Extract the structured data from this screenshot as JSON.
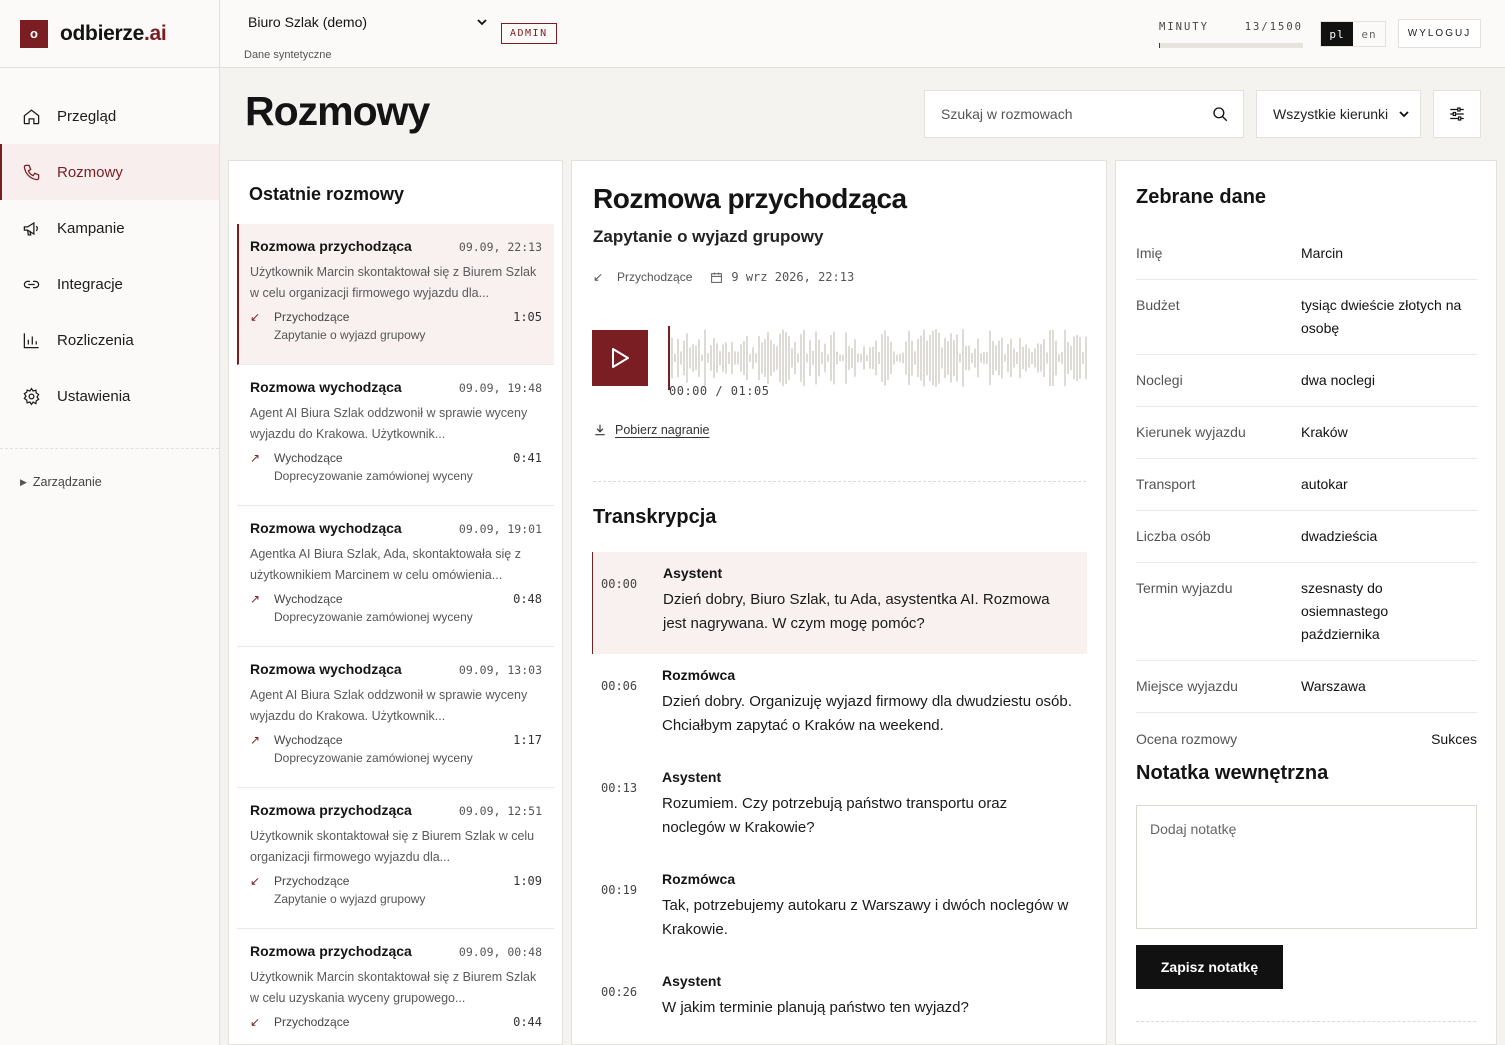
{
  "brand": {
    "mark": "o",
    "name": "odbierze",
    "suffix": ".ai"
  },
  "sidebar": {
    "items": [
      {
        "label": "Przegląd",
        "icon": "home-icon"
      },
      {
        "label": "Rozmowy",
        "icon": "phone-icon"
      },
      {
        "label": "Kampanie",
        "icon": "megaphone-icon"
      },
      {
        "label": "Integracje",
        "icon": "link-icon"
      },
      {
        "label": "Rozliczenia",
        "icon": "bar-chart-icon"
      },
      {
        "label": "Ustawienia",
        "icon": "gear-icon"
      }
    ],
    "manage": "Zarządzanie"
  },
  "topbar": {
    "org": "Biuro Szlak (demo)",
    "org_sub": "Dane syntetyczne",
    "badge": "ADMIN",
    "minutes_label": "MINUTY",
    "minutes_value": "13/1500",
    "minutes_used": 13,
    "minutes_total": 1500,
    "lang_pl": "pl",
    "lang_en": "en",
    "logout": "WYLOGUJ"
  },
  "page": {
    "title": "Rozmowy",
    "search_placeholder": "Szukaj w rozmowach",
    "filter": "Wszystkie kierunki"
  },
  "list": {
    "title": "Ostatnie rozmowy",
    "calls": [
      {
        "title": "Rozmowa przychodząca",
        "time": "09.09, 22:13",
        "summary": "Użytkownik Marcin skontaktował się z Biurem Szlak w celu organizacji firmowego wyjazdu dla...",
        "direction": "Przychodzące",
        "arrow": "↙",
        "duration": "1:05",
        "topic": "Zapytanie o wyjazd grupowy"
      },
      {
        "title": "Rozmowa wychodząca",
        "time": "09.09, 19:48",
        "summary": "Agent AI Biura Szlak oddzwonił w sprawie wyceny wyjazdu do Krakowa. Użytkownik...",
        "direction": "Wychodzące",
        "arrow": "↗",
        "duration": "0:41",
        "topic": "Doprecyzowanie zamówionej wyceny"
      },
      {
        "title": "Rozmowa wychodząca",
        "time": "09.09, 19:01",
        "summary": "Agentka AI Biura Szlak, Ada, skontaktowała się z użytkownikiem Marcinem w celu omówienia...",
        "direction": "Wychodzące",
        "arrow": "↗",
        "duration": "0:48",
        "topic": "Doprecyzowanie zamówionej wyceny"
      },
      {
        "title": "Rozmowa wychodząca",
        "time": "09.09, 13:03",
        "summary": "Agent AI Biura Szlak oddzwonił w sprawie wyceny wyjazdu do Krakowa. Użytkownik...",
        "direction": "Wychodzące",
        "arrow": "↗",
        "duration": "1:17",
        "topic": "Doprecyzowanie zamówionej wyceny"
      },
      {
        "title": "Rozmowa przychodząca",
        "time": "09.09, 12:51",
        "summary": "Użytkownik skontaktował się z Biurem Szlak w celu organizacji firmowego wyjazdu dla...",
        "direction": "Przychodzące",
        "arrow": "↙",
        "duration": "1:09",
        "topic": "Zapytanie o wyjazd grupowy"
      },
      {
        "title": "Rozmowa przychodząca",
        "time": "09.09, 00:48",
        "summary": "Użytkownik Marcin skontaktował się z Biurem Szlak w celu uzyskania wyceny grupowego...",
        "direction": "Przychodzące",
        "arrow": "↙",
        "duration": "0:44",
        "topic": ""
      }
    ]
  },
  "detail": {
    "title": "Rozmowa przychodząca",
    "subtitle": "Zapytanie o wyjazd grupowy",
    "direction": "Przychodzące",
    "datetime": "9 wrz 2026, 22:13",
    "player_time": "00:00 / 01:05",
    "download": "Pobierz nagranie",
    "transcript_title": "Transkrypcja",
    "transcript": [
      {
        "ts": "00:00",
        "who": "Asystent",
        "text": "Dzień dobry, Biuro Szlak, tu Ada, asystentka AI. Rozmowa jest nagrywana. W czym mogę pomóc?"
      },
      {
        "ts": "00:06",
        "who": "Rozmówca",
        "text": "Dzień dobry. Organizuję wyjazd firmowy dla dwudziestu osób. Chciałbym zapytać o Kraków na weekend."
      },
      {
        "ts": "00:13",
        "who": "Asystent",
        "text": "Rozumiem. Czy potrzebują państwo transportu oraz noclegów w Krakowie?"
      },
      {
        "ts": "00:19",
        "who": "Rozmówca",
        "text": "Tak, potrzebujemy autokaru z Warszawy i dwóch noclegów w Krakowie."
      },
      {
        "ts": "00:26",
        "who": "Asystent",
        "text": "W jakim terminie planują państwo ten wyjazd?"
      }
    ]
  },
  "collected": {
    "title": "Zebrane dane",
    "fields": [
      {
        "k": "Imię",
        "v": "Marcin"
      },
      {
        "k": "Budżet",
        "v": "tysiąc dwieście złotych na osobę"
      },
      {
        "k": "Noclegi",
        "v": "dwa noclegi"
      },
      {
        "k": "Kierunek wyjazdu",
        "v": "Kraków"
      },
      {
        "k": "Transport",
        "v": "autokar"
      },
      {
        "k": "Liczba osób",
        "v": "dwadzieścia"
      },
      {
        "k": "Termin wyjazdu",
        "v": "szesnasty do osiemnastego października"
      },
      {
        "k": "Miejsce wyjazdu",
        "v": "Warszawa"
      }
    ],
    "rating_label": "Ocena rozmowy",
    "rating_value": "Sukces",
    "note_title": "Notatka wewnętrzna",
    "note_placeholder": "Dodaj notatkę",
    "note_button": "Zapisz notatkę"
  },
  "colors": {
    "accent": "#7a1e24",
    "highlight": "#f9f1f0"
  }
}
